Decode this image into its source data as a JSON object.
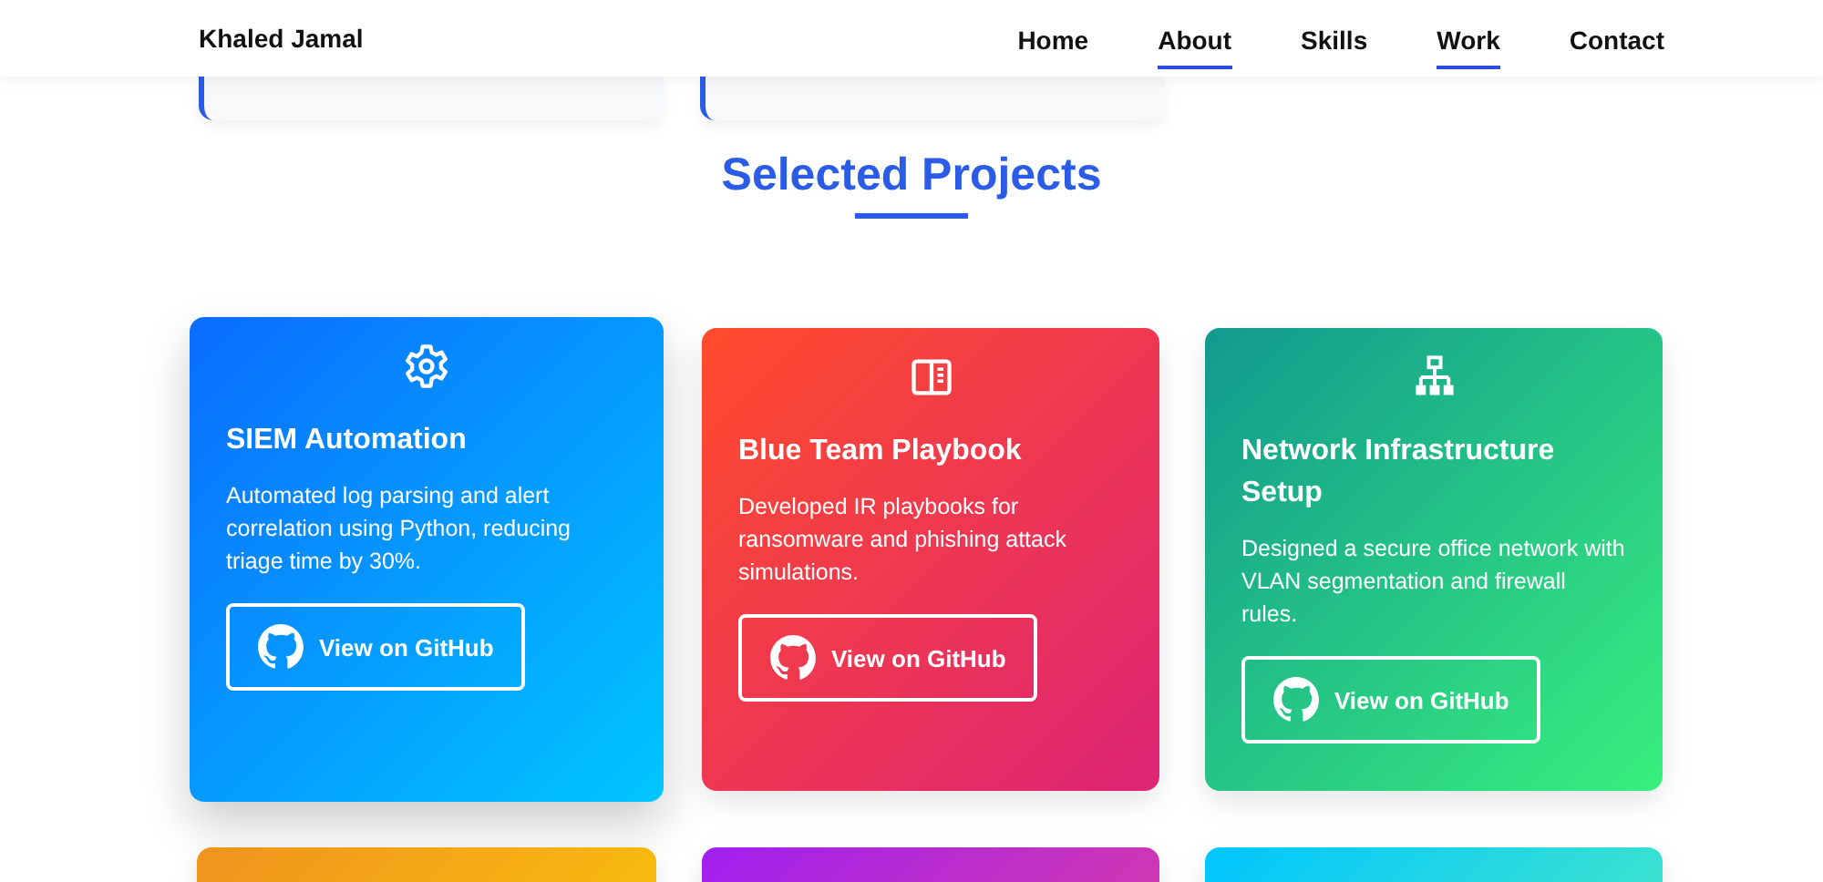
{
  "brand": "Khaled Jamal",
  "nav": [
    {
      "label": "Home",
      "selected": false
    },
    {
      "label": "About",
      "selected": true
    },
    {
      "label": "Skills",
      "selected": false
    },
    {
      "label": "Work",
      "selected": true
    },
    {
      "label": "Contact",
      "selected": false
    }
  ],
  "section_title": "Selected Projects",
  "projects": [
    {
      "kind": "gear",
      "title": "SIEM Automation",
      "description": "Automated log parsing and alert correlation using Python, reducing triage time by 30%.",
      "link": "View on GitHub",
      "raised": true,
      "color": "#0a6cff"
    },
    {
      "kind": "panel",
      "title": "Blue Team Playbook",
      "description": "Developed IR playbooks for ransomware and phishing attack simulations.",
      "link": "View on GitHub",
      "raised": false,
      "color": "#ff4b2b"
    },
    {
      "kind": "network",
      "title": "Network Infrastructure Setup",
      "description": "Designed a secure office network with VLAN segmentation and firewall rules.",
      "link": "View on GitHub",
      "raised": false,
      "color": "#11998e"
    }
  ],
  "more_projects": [
    {
      "color": "#f0931e"
    },
    {
      "color": "#a020f0"
    },
    {
      "color": "#00c6ff"
    }
  ]
}
